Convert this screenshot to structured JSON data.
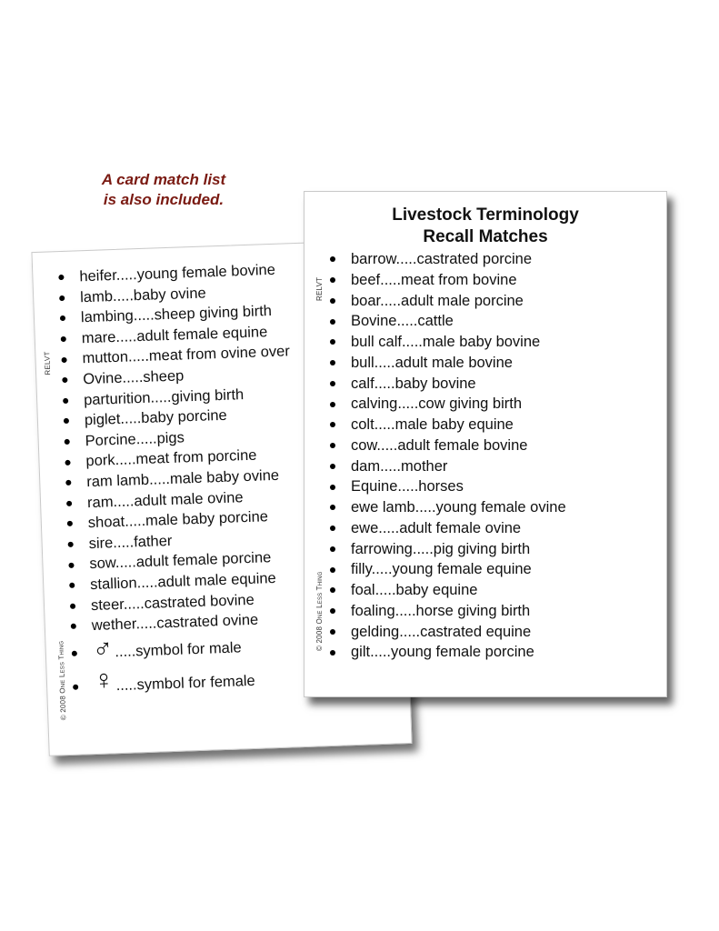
{
  "caption": {
    "line1": "A card match list",
    "line2": "is also included.",
    "color": "#7a1a12"
  },
  "right_card": {
    "title_line1": "Livestock Terminology",
    "title_line2": "Recall Matches",
    "side_code": "RELVT",
    "copyright": "© 2008 One Less Thing",
    "items": [
      "barrow.....castrated porcine",
      "beef.....meat from bovine",
      "boar.....adult male porcine",
      "Bovine.....cattle",
      "bull calf.....male baby bovine",
      "bull.....adult male bovine",
      "calf.....baby bovine",
      "calving.....cow giving birth",
      "colt.....male baby equine",
      "cow.....adult female bovine",
      "dam.....mother",
      "Equine.....horses",
      "ewe lamb.....young female ovine",
      "ewe.....adult female ovine",
      "farrowing.....pig giving birth",
      "filly.....young female equine",
      "foal.....baby equine",
      "foaling.....horse giving birth",
      "gelding.....castrated equine",
      "gilt.....young female porcine"
    ]
  },
  "left_card": {
    "side_code": "RELVT",
    "copyright": "© 2008 One Less Thing",
    "items": [
      "heifer.....young female bovine",
      "lamb.....baby ovine",
      "lambing.....sheep giving birth",
      "mare.....adult female equine",
      "mutton.....meat from ovine over",
      "Ovine.....sheep",
      "parturition.....giving birth",
      "piglet.....baby porcine",
      "Porcine.....pigs",
      "pork.....meat from porcine",
      "ram lamb.....male baby ovine",
      "ram.....adult male ovine",
      "shoat.....male baby porcine",
      "sire.....father",
      "sow.....adult female porcine",
      "stallion.....adult male equine",
      "steer.....castrated bovine",
      "wether.....castrated ovine"
    ],
    "symbols": [
      {
        "icon": "male-symbol-icon",
        "glyph": "♂",
        "text": ".....symbol for male"
      },
      {
        "icon": "female-symbol-icon",
        "glyph": "♀",
        "text": ".....symbol for female"
      }
    ]
  }
}
